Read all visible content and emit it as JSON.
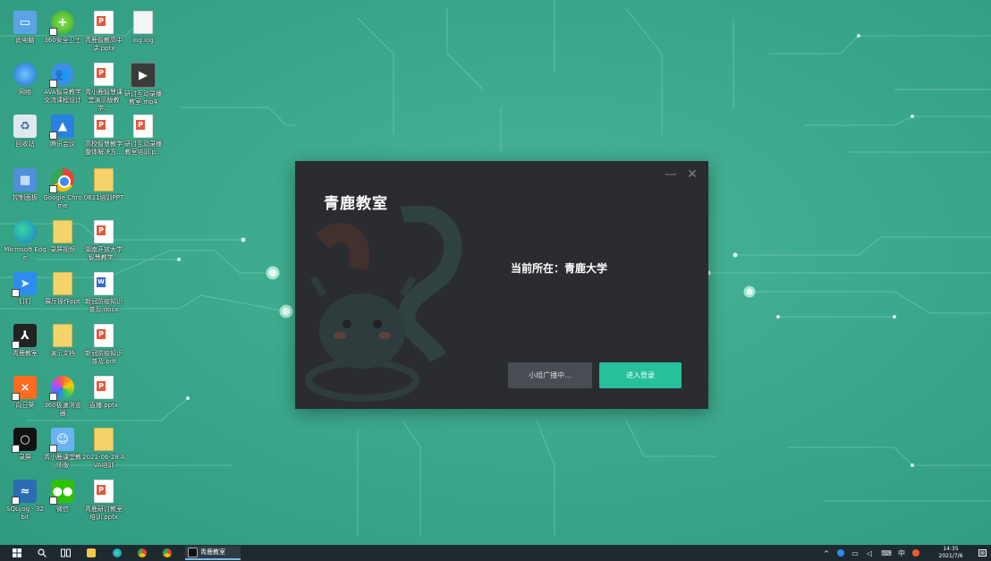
{
  "desktop": {
    "icons": [
      {
        "label": "此电脑"
      },
      {
        "label": "360安全卫士"
      },
      {
        "label": "青鹿智教高中讲.pptx"
      },
      {
        "label": "log.log"
      },
      {
        "label": "网络"
      },
      {
        "label": "AVA智导教学交流课程设计"
      },
      {
        "label": "青小鹿智慧课堂演示版教学..."
      },
      {
        "label": "研讨互动录播教室.mp4"
      },
      {
        "label": "回收站"
      },
      {
        "label": "腾讯会议"
      },
      {
        "label": "高校智慧教学整体解决方..."
      },
      {
        "label": "研讨互动录播教室培训.p..."
      },
      {
        "label": "控制面板"
      },
      {
        "label": "Google Chrome"
      },
      {
        "label": "0611培训PPT"
      },
      {
        "label": "Microsoft Edge"
      },
      {
        "label": "录屏视频"
      },
      {
        "label": "湖南开放大学智慧教学..."
      },
      {
        "label": "钉钉"
      },
      {
        "label": "展厅操作ppt"
      },
      {
        "label": "新冠防疫知识普及.docx"
      },
      {
        "label": "青鹿教室"
      },
      {
        "label": "演示文档"
      },
      {
        "label": "新冠防疫知识普及.pdf"
      },
      {
        "label": "向日葵"
      },
      {
        "label": "360极速浏览器"
      },
      {
        "label": "直播.pptx"
      },
      {
        "label": "录屏"
      },
      {
        "label": "青小鹿课堂教师版"
      },
      {
        "label": "2021-06-28 AVA培训"
      },
      {
        "label": "SQLyog - 32 bit"
      },
      {
        "label": "微信"
      },
      {
        "label": "青鹿研讨教室培训.pptx"
      }
    ]
  },
  "dialog": {
    "title": "青鹿教室",
    "minimize_glyph": "—",
    "close_glyph": "✕",
    "current_location": "当前所在：青鹿大学",
    "broadcast_button": "小组广播中...",
    "login_button": "进入登录"
  },
  "taskbar": {
    "app_label": "青鹿教室",
    "ime": "中",
    "time": "14:35",
    "date": "2021/7/6"
  },
  "colors": {
    "desktop_bg": "#3aa88c",
    "dialog_bg": "#2a2c30",
    "accent": "#26c09b",
    "taskbar_bg": "#1f2a30"
  }
}
